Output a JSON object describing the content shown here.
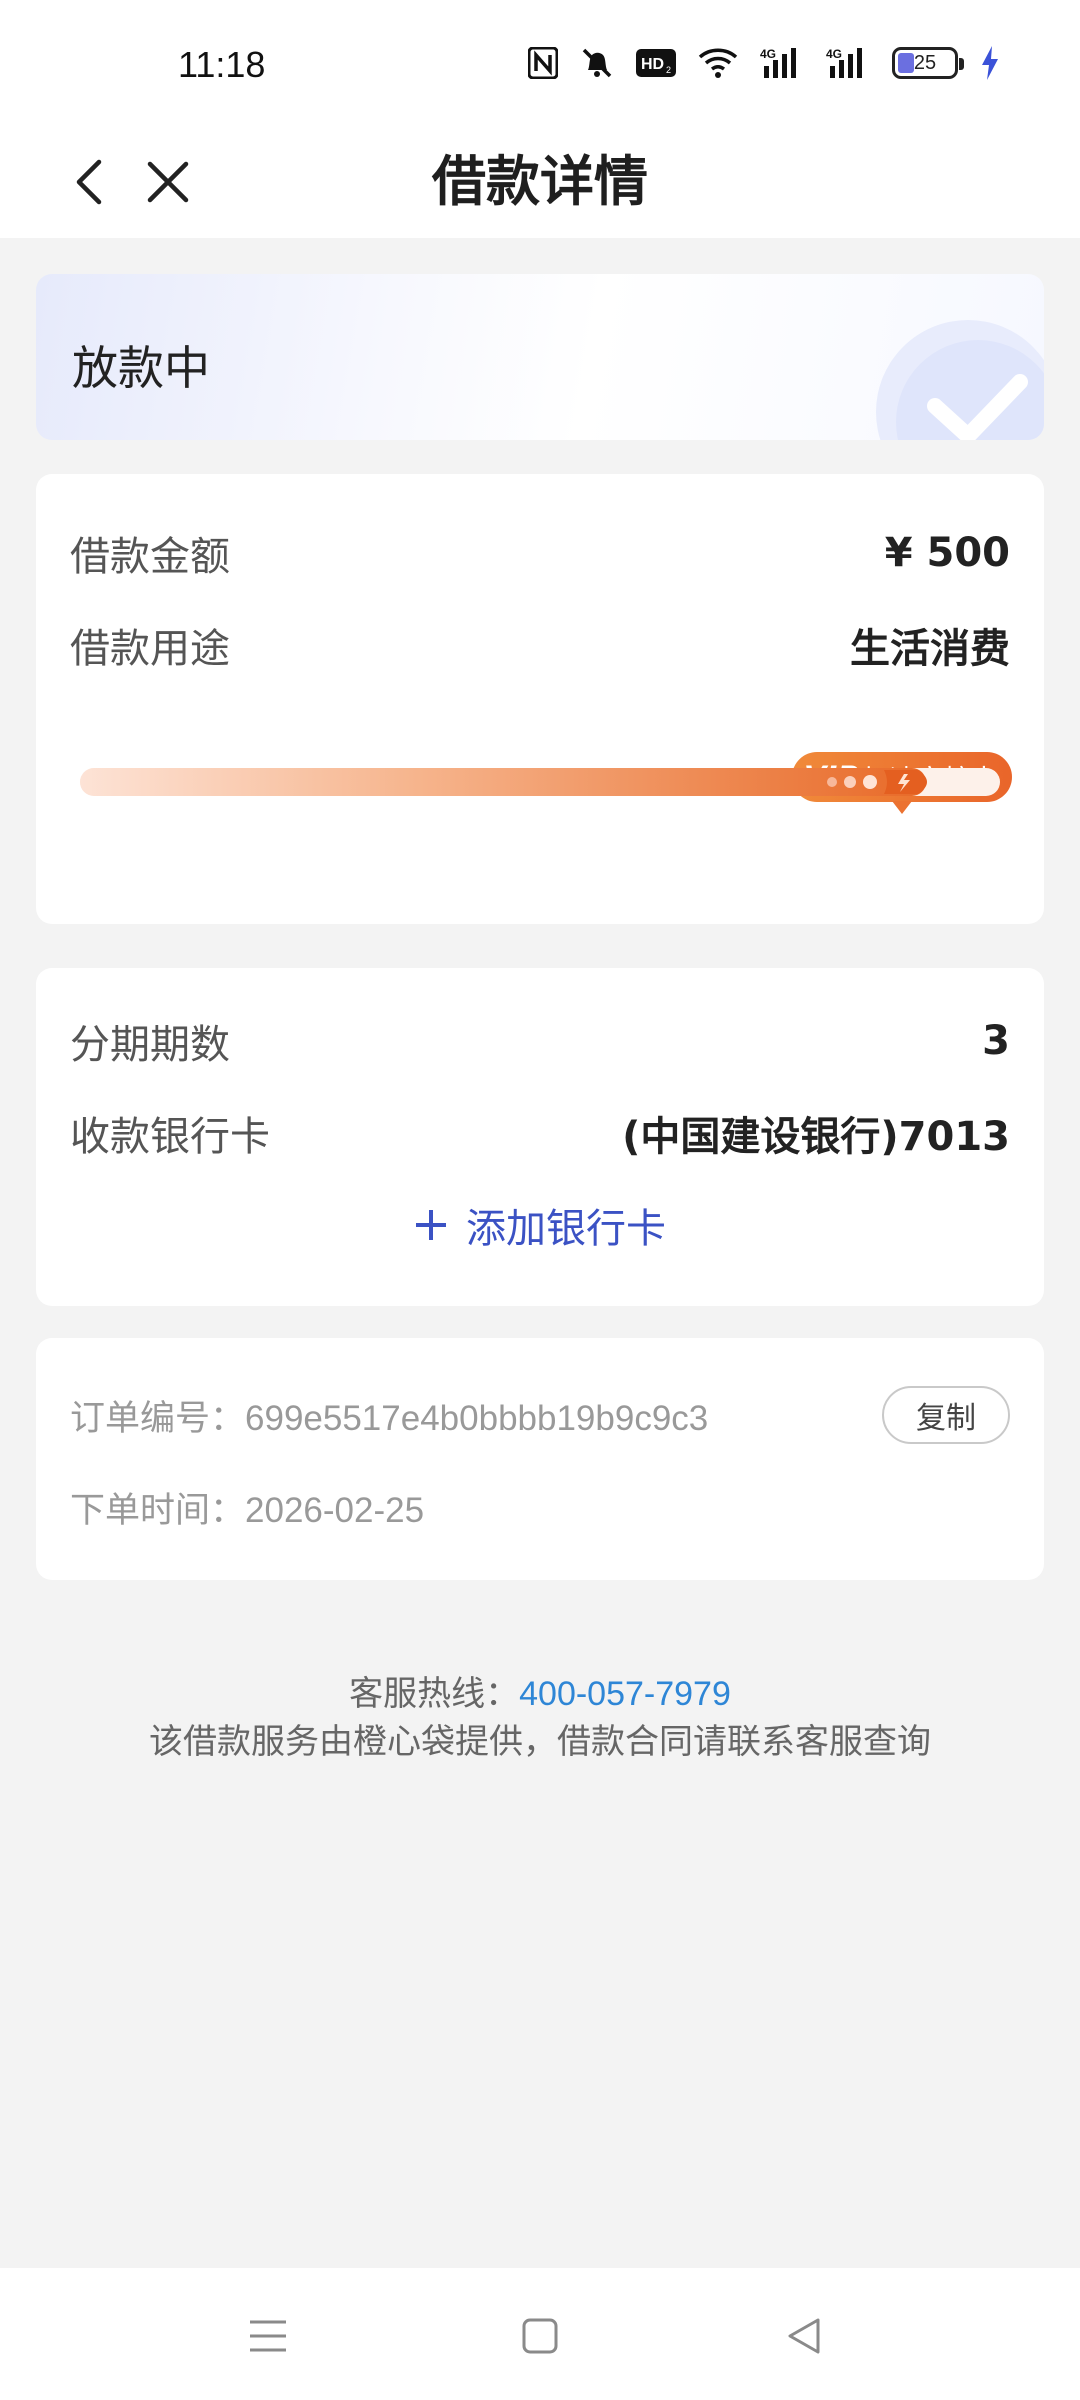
{
  "status_bar": {
    "time": "11:18",
    "battery_level": "25",
    "icons": [
      "nfc-icon",
      "silent-bell-icon",
      "hd-icon",
      "wifi-icon",
      "signal-4g-icon",
      "signal-4g-icon",
      "battery-icon",
      "charging-icon"
    ]
  },
  "header": {
    "title": "借款详情",
    "back_icon": "back-arrow-icon",
    "close_icon": "close-icon"
  },
  "status_card": {
    "status": "放款中",
    "icon": "check-icon"
  },
  "loan": {
    "amount_label": "借款金额",
    "amount_value": "¥ 500",
    "purpose_label": "借款用途",
    "purpose_value": "生活消费",
    "vip_mark": "VIP",
    "vip_text": "加速审核中",
    "progress": 0.92
  },
  "installment": {
    "periods_label": "分期期数",
    "periods_value": "3",
    "bank_label": "收款银行卡",
    "bank_value": "(中国建设银行)7013",
    "add_card_label": "添加银行卡"
  },
  "order": {
    "number_label": "订单编号：",
    "number_value": "699e5517e4b0bbbb19b9c9c3",
    "copy_label": "复制",
    "time_label": "下单时间：",
    "time_value": "2026-02-25"
  },
  "footer": {
    "hotline_label": "客服热线：",
    "hotline_number": "400-057-7979",
    "note": "该借款服务由橙心袋提供，借款合同请联系客服查询"
  },
  "colors": {
    "accent_blue": "#3b52c4",
    "link_blue": "#2e86d6",
    "vip_orange": "#e9652a",
    "background": "#f3f3f3"
  }
}
